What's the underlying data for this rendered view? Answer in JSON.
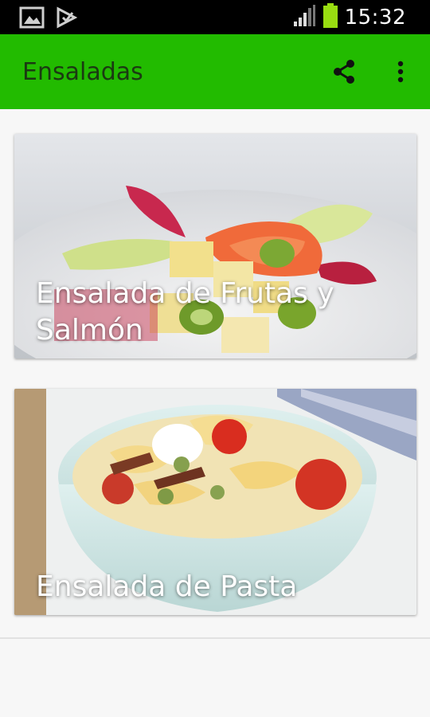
{
  "status_bar": {
    "time": "15:32",
    "icons": [
      "image-icon",
      "check-notification-icon",
      "signal-icon",
      "battery-icon"
    ]
  },
  "app_bar": {
    "title": "Ensaladas",
    "actions": [
      "share-icon",
      "overflow-menu-icon"
    ],
    "color": "#22bb00"
  },
  "recipes": [
    {
      "title": "Ensalada de Frutas y Salmón"
    },
    {
      "title": "Ensalada de Pasta"
    }
  ]
}
